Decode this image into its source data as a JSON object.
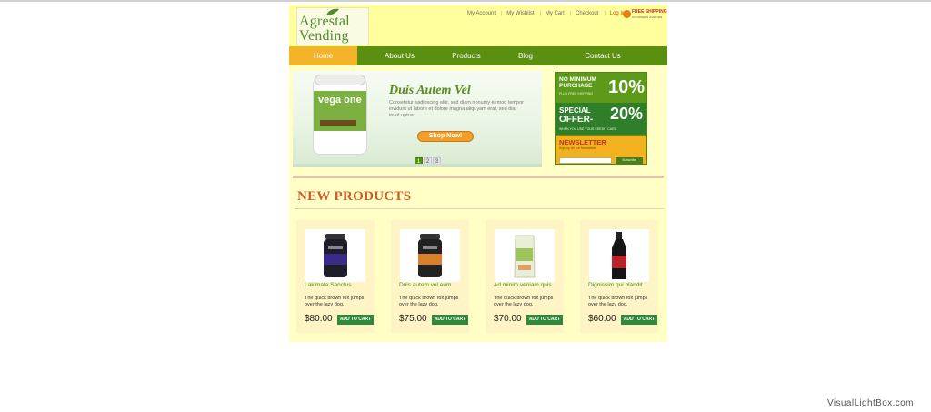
{
  "site": {
    "logo": {
      "line1": "Agrestal",
      "line2": "Vending"
    },
    "top_links": [
      "My Account",
      "My Wishlist",
      "My Cart",
      "Checkout",
      "Log In"
    ],
    "free_shipping": {
      "title": "FREE SHIPPING",
      "sub": "ON ORDERS OVER $99"
    }
  },
  "nav": {
    "items": [
      {
        "label": "Home",
        "active": true
      },
      {
        "label": "About Us",
        "active": false
      },
      {
        "label": "Products",
        "active": false
      },
      {
        "label": "Blog",
        "active": false
      },
      {
        "label": "Contact Us",
        "active": false
      }
    ]
  },
  "slider": {
    "product_brand": "vega one",
    "title": "Duis Autem Vel",
    "text": "Consetetur sadipscing elitr, sed diam nonumy eirmod tempor invidunt ut labore et dolore magna aliquyam erat, sed dia invoLuptua.",
    "button": "Shop Now!",
    "pages": [
      "1",
      "2",
      "3"
    ],
    "active_page": "1"
  },
  "promo": {
    "row1": {
      "line1": "NO MINIMUM",
      "line2": "PURCHASE",
      "sub": "PLUS FREE SHIPPING",
      "value": "10%"
    },
    "row2": {
      "line1": "SPECIAL",
      "line2": "OFFER-",
      "value": "20%",
      "sub": "WHEN YOU USE YOUR CREDIT CARD"
    },
    "newsletter": {
      "title": "NEWSLETTER",
      "sub": "Sign up for our Newsletter",
      "button": "Subscribe"
    }
  },
  "new_products": {
    "heading": "NEW PRODUCTS",
    "items": [
      {
        "name": "Lakimata Sanctus",
        "desc": "The quick brown fox jumps over the lazy dog.",
        "price": "$80.00",
        "button": "ADD TO CART",
        "color": "#3a2a8a"
      },
      {
        "name": "Duis autem vel eum",
        "desc": "The quick brown fox jumps over the lazy dog.",
        "price": "$75.00",
        "button": "ADD TO CART",
        "color": "#d8802a"
      },
      {
        "name": "Ad minim veniam quis",
        "desc": "The quick brown fox jumps over the lazy dog.",
        "price": "$70.00",
        "button": "ADD TO CART",
        "color": "#c8d89a"
      },
      {
        "name": "Dignissim qui blandit",
        "desc": "The quick brown fox jumps over the lazy dog.",
        "price": "$60.00",
        "button": "ADD TO CART",
        "color": "#c0202a"
      }
    ]
  },
  "watermark": "VisualLightBox.com",
  "colors": {
    "nav_green": "#5a8f0f",
    "nav_active": "#f4b428",
    "header_bg": "#ffff9e",
    "page_bg": "#ffffc6",
    "cart_green": "#2d8a38"
  }
}
